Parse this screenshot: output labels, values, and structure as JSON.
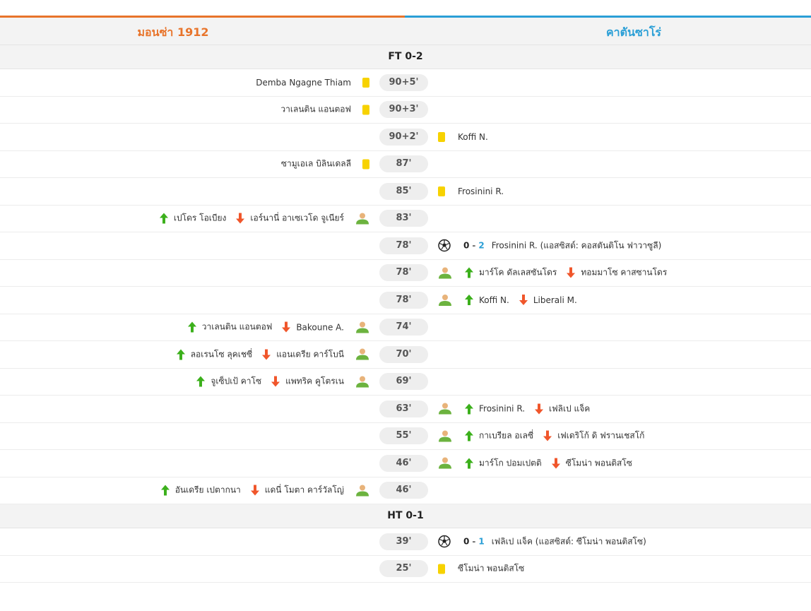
{
  "colors": {
    "home": "#e8742b",
    "away": "#2b9fd6",
    "card": "#f7d200",
    "in": "#3cb01c",
    "out": "#f0562b"
  },
  "teams": {
    "home": "มอนซ่า 1912",
    "away": "คาตันซาโร่"
  },
  "sections": {
    "ft": "FT 0-2",
    "ht": "HT 0-1"
  },
  "events": [
    {
      "minute": "90+5'",
      "home": {
        "type": "card",
        "player": "Demba Ngagne Thiam"
      }
    },
    {
      "minute": "90+3'",
      "home": {
        "type": "card",
        "player": "วาเลนติน แอนตอฟ"
      }
    },
    {
      "minute": "90+2'",
      "away": {
        "type": "card",
        "player": "Koffi N."
      }
    },
    {
      "minute": "87'",
      "home": {
        "type": "card",
        "player": "ซามูเอเล บิลินเดลลี"
      }
    },
    {
      "minute": "85'",
      "away": {
        "type": "card",
        "player": "Frosinini R."
      }
    },
    {
      "minute": "83'",
      "home": {
        "type": "sub",
        "in": "เปโดร โอเบียง",
        "out": "เอร์นานี่ อาเซเวโด จูเนียร์"
      }
    },
    {
      "minute": "78'",
      "away": {
        "type": "goal",
        "score_home": "0",
        "dash": "-",
        "score_away": "2",
        "text": "Frosinini R. (แอสซิสต์: คอสตันติโน ฟาวาซูลี)"
      }
    },
    {
      "minute": "78'",
      "away": {
        "type": "sub",
        "in": "มาร์โค ดัลเลสซันโดร",
        "out": "ทอมมาโซ คาสซานโดร"
      }
    },
    {
      "minute": "78'",
      "away": {
        "type": "sub",
        "in": "Koffi N.",
        "out": "Liberali M."
      }
    },
    {
      "minute": "74'",
      "home": {
        "type": "sub",
        "in": "วาเลนติน แอนตอฟ",
        "out": "Bakoune A."
      }
    },
    {
      "minute": "70'",
      "home": {
        "type": "sub",
        "in": "ลอเรนโซ ลุคเชซี่",
        "out": "แอนเดรีย คาร์โบนี"
      }
    },
    {
      "minute": "69'",
      "home": {
        "type": "sub",
        "in": "จูเซ็ปเป้ คาโซ",
        "out": "แพทริค คูโตรเน"
      }
    },
    {
      "minute": "63'",
      "away": {
        "type": "sub",
        "in": "Frosinini R.",
        "out": "เฟลิเป แจ็ค"
      }
    },
    {
      "minute": "55'",
      "away": {
        "type": "sub",
        "in": "กาเบรียล อเลซี่",
        "out": "เฟเดริโก้ ดิ ฟรานเชสโก้"
      }
    },
    {
      "minute": "46'",
      "away": {
        "type": "sub",
        "in": "มาร์โก ปอมเปตติ",
        "out": "ซีโมน่า พอนติสโซ"
      }
    },
    {
      "minute": "46'",
      "home": {
        "type": "sub",
        "in": "อันเดรีย เปตากนา",
        "out": "แดนี่ โมตา คาร์วัลโญ่"
      }
    },
    {
      "section": "ht"
    },
    {
      "minute": "39'",
      "away": {
        "type": "goal",
        "score_home": "0",
        "dash": "-",
        "score_away": "1",
        "text": "เฟลิเป แจ็ค (แอสซิสต์: ซีโมน่า พอนติสโซ)"
      }
    },
    {
      "minute": "25'",
      "away": {
        "type": "card",
        "player": "ซีโมน่า พอนติสโซ"
      }
    }
  ]
}
